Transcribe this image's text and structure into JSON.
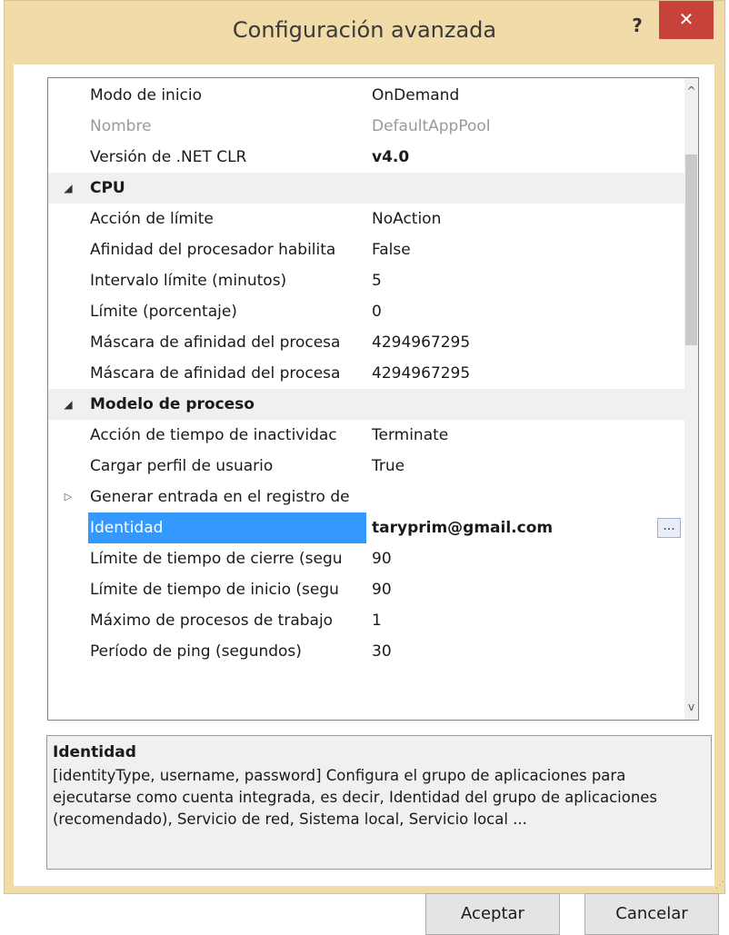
{
  "window": {
    "title": "Configuración avanzada",
    "help": "?",
    "close": "✕"
  },
  "grid": {
    "rows": [
      {
        "kind": "prop",
        "name": "Modo de inicio",
        "value": "OnDemand"
      },
      {
        "kind": "prop",
        "name": "Nombre",
        "value": "DefaultAppPool",
        "dim": true
      },
      {
        "kind": "prop",
        "name": "Versión de .NET CLR",
        "value": "v4.0",
        "bold": true
      },
      {
        "kind": "cat",
        "name": "CPU",
        "expander": "◢"
      },
      {
        "kind": "prop",
        "name": "Acción de límite",
        "value": "NoAction"
      },
      {
        "kind": "prop",
        "name": "Afinidad del procesador habilita",
        "value": "False"
      },
      {
        "kind": "prop",
        "name": "Intervalo límite (minutos)",
        "value": "5"
      },
      {
        "kind": "prop",
        "name": "Límite (porcentaje)",
        "value": "0"
      },
      {
        "kind": "prop",
        "name": "Máscara de afinidad del procesa",
        "value": "4294967295"
      },
      {
        "kind": "prop",
        "name": "Máscara de afinidad del procesa",
        "value": "4294967295"
      },
      {
        "kind": "cat",
        "name": "Modelo de proceso",
        "expander": "◢"
      },
      {
        "kind": "prop",
        "name": "Acción de tiempo de inactividac",
        "value": "Terminate"
      },
      {
        "kind": "prop",
        "name": "Cargar perfil de usuario",
        "value": "True"
      },
      {
        "kind": "prop",
        "name": "Generar entrada en el registro de",
        "value": "",
        "expander": "▷"
      },
      {
        "kind": "prop",
        "name": "Identidad",
        "value": "taryprim@gmail.com",
        "bold": true,
        "selected": true,
        "button": "..."
      },
      {
        "kind": "prop",
        "name": "Límite de tiempo de cierre (segu",
        "value": "90"
      },
      {
        "kind": "prop",
        "name": "Límite de tiempo de inicio (segu",
        "value": "90"
      },
      {
        "kind": "prop",
        "name": "Máximo de procesos de trabajo",
        "value": "1"
      },
      {
        "kind": "prop",
        "name": "Período de ping (segundos)",
        "value": "30"
      }
    ]
  },
  "scrollbar": {
    "up": "^",
    "down": "v"
  },
  "description": {
    "title": "Identidad",
    "text": "[identityType, username, password] Configura el grupo de aplicaciones para ejecutarse como cuenta integrada, es decir, Identidad del grupo de aplicaciones (recomendado), Servicio de red, Sistema local, Servicio local ..."
  },
  "buttons": {
    "ok": "Aceptar",
    "cancel": "Cancelar"
  },
  "grip": "⋰",
  "colors": {
    "frame": "#f1dba8",
    "close": "#c9413b",
    "selection": "#3399ff"
  }
}
